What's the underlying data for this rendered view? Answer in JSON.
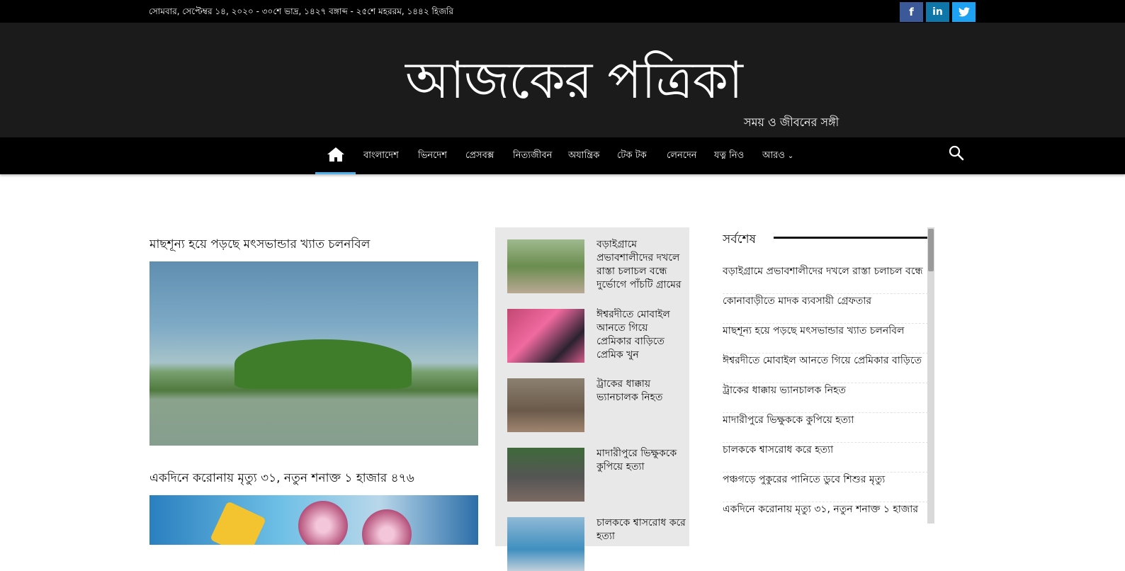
{
  "topbar": {
    "date": "সোমবার, সেপ্টেম্বর ১৪, ২০২০ - ৩০শে ভাদ্র, ১৪২৭ বঙ্গাব্দ - ২৫শে মহররম, ১৪৪২ হিজরি",
    "social": [
      {
        "icon": "facebook-icon",
        "glyph": "f",
        "color": "#3b5998"
      },
      {
        "icon": "linkedin-icon",
        "glyph": "in",
        "color": "#0e76a8"
      },
      {
        "icon": "twitter-icon",
        "glyph": "t",
        "color": "#1da1f2"
      }
    ]
  },
  "masthead": {
    "logo": "আজকের পত্রিকা",
    "tagline": "সময় ও জীবনের সঙ্গী"
  },
  "nav": {
    "home_icon": "home-icon",
    "items": [
      "বাংলাদেশ",
      "ভিনদেশ",
      "প্রেসবক্স",
      "নিত্যজীবন",
      "অযান্ত্রিক",
      "টেক টক",
      "লেনদেন",
      "যত্ন নিও",
      "আরও"
    ],
    "more_caret": "⌄",
    "search_icon": "search-icon",
    "accent": "#4db2ec"
  },
  "main": {
    "lead": [
      {
        "title": "মাছশূন্য হয়ে পড়ছে মৎসভান্ডার খ্যাত চলনবিল"
      },
      {
        "title": "একদিনে করোনায় মৃত্যু ৩১, নতুন শনাক্ত ১ হাজার ৪৭৬"
      }
    ],
    "middle": [
      {
        "title": "বড়াইগ্রামে প্রভাবশালীদের দখলে রাস্তা চলাচল বন্ধে দুর্ভোগে পাঁচটি গ্রামের"
      },
      {
        "title": "ঈশ্বরদীতে মোবাইল আনতে গিয়ে প্রেমিকার বাড়িতে প্রেমিক খুন"
      },
      {
        "title": "ট্রাকের ধাক্কায় ভ্যানচালক নিহত"
      },
      {
        "title": "মাদারীপুরে ভিক্ষুককে কুপিয়ে হত্যা"
      },
      {
        "title": "চালককে শ্বাসরোধ করে হত্যা"
      }
    ]
  },
  "sidebar": {
    "heading": "সর্বশেষ",
    "items": [
      "বড়াইগ্রামে প্রভাবশালীদের দখলে রাস্তা চলাচল বন্ধে",
      "কোনাবাড়ীতে মাদক ব্যবসায়ী গ্রেফতার",
      "মাছশূন্য হয়ে পড়ছে মৎসভান্ডার খ্যাত চলনবিল",
      "ঈশ্বরদীতে মোবাইল আনতে গিয়ে প্রেমিকার বাড়িতে",
      "ট্রাকের ধাক্কায় ভ্যানচালক নিহত",
      "মাদারীপুরে ভিক্ষুককে কুপিয়ে হত্যা",
      "চালককে শ্বাসরোধ করে হত্যা",
      "পঞ্চগড়ে পুকুরের পানিতে ডুবে শিশুর মৃত্যু",
      "একদিনে করোনায় মৃত্যু ৩১, নতুন শনাক্ত ১ হাজার"
    ]
  }
}
